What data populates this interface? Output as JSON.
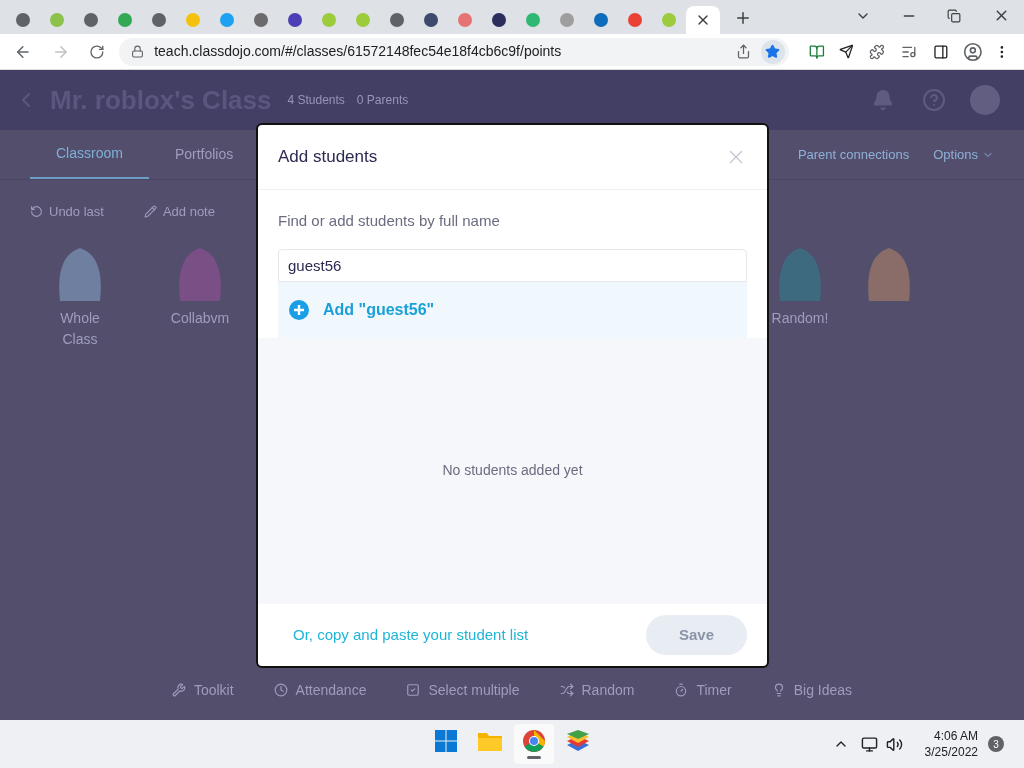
{
  "browser": {
    "tabs": [
      {
        "color": "#5f6368",
        "selected": false
      },
      {
        "color": "#8bc34a",
        "selected": false
      },
      {
        "color": "#5f6368",
        "selected": false
      },
      {
        "color": "#34a853",
        "selected": false
      },
      {
        "color": "#5f6368",
        "selected": false
      },
      {
        "color": "#f4c20d",
        "selected": false
      },
      {
        "color": "#1da1f2",
        "selected": false
      },
      {
        "color": "#6b6b6b",
        "selected": false
      },
      {
        "color": "#4a3fb5",
        "selected": false
      },
      {
        "color": "#9ccc3c",
        "selected": false
      },
      {
        "color": "#9ccc3c",
        "selected": false
      },
      {
        "color": "#5f6368",
        "selected": false
      },
      {
        "color": "#3c4a6b",
        "selected": false
      },
      {
        "color": "#e57373",
        "selected": false
      },
      {
        "color": "#2b2d5c",
        "selected": false
      },
      {
        "color": "#2eb872",
        "selected": false
      },
      {
        "color": "#9e9e9e",
        "selected": false
      },
      {
        "color": "#0f6cbd",
        "selected": false
      },
      {
        "color": "#ea4335",
        "selected": false
      },
      {
        "color": "#9ccc3c",
        "selected": false
      },
      {
        "color": "#ffffff",
        "selected": true
      }
    ],
    "url": "teach.classdojo.com/#/classes/61572148fec54e18f4cb6c9f/points",
    "bookmarked": true
  },
  "page": {
    "class_title": "Mr. roblox's Class",
    "student_count": "4 Students",
    "parent_count": "0 Parents",
    "nav_tabs": [
      {
        "label": "Classroom",
        "selected": true
      },
      {
        "label": "Portfolios",
        "selected": false
      }
    ],
    "right_links": [
      "Parent connections",
      "Options"
    ],
    "actions": [
      "Undo last",
      "Add note"
    ],
    "students": [
      {
        "name": "Whole Class",
        "color": "#6f7fa0"
      },
      {
        "name": "Collabvm",
        "color": "#7a4f86"
      },
      {
        "name": "Random!",
        "color": "#3e6a80"
      }
    ],
    "toolbar": [
      "Toolkit",
      "Attendance",
      "Select multiple",
      "Random",
      "Timer",
      "Big Ideas"
    ]
  },
  "dialog": {
    "title": "Add students",
    "field_label": "Find or add students by full name",
    "field_value": "guest56",
    "suggestion": "Add \"guest56\"",
    "empty_text": "No students added yet",
    "paste_link": "Or, copy and paste your student list",
    "save": {
      "label": "Save",
      "disabled": true
    }
  },
  "taskbar": {
    "apps": [
      {
        "kind": "windows",
        "selected": false
      },
      {
        "kind": "folder",
        "selected": false
      },
      {
        "kind": "chrome",
        "selected": true
      },
      {
        "kind": "stack",
        "selected": false
      }
    ],
    "time": "4:06 AM",
    "date": "3/25/2022",
    "notifications": "3"
  }
}
